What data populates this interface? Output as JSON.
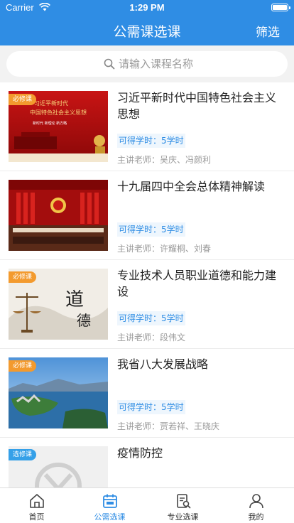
{
  "status": {
    "carrier": "Carrier",
    "time": "1:29 PM"
  },
  "header": {
    "title": "公需课选课",
    "filter_label": "筛选"
  },
  "search": {
    "placeholder": "请输入课程名称"
  },
  "courses": [
    {
      "tag": "必修课",
      "title": "习近平新时代中国特色社会主义思想",
      "hours": "可得学时：5学时",
      "teacher": "主讲老师：吴庆、冯颜利",
      "banner_line1": "习近平新时代",
      "banner_line2": "中国特色社会主义思想",
      "banner_line3": "新时代  新理论  新方略"
    },
    {
      "tag": "",
      "title": "十九届四中全会总体精神解读",
      "hours": "可得学时：5学时",
      "teacher": "主讲老师：许耀桐、刘春"
    },
    {
      "tag": "必修课",
      "title": "专业技术人员职业道德和能力建设",
      "hours": "可得学时：5学时",
      "teacher": "主讲老师：段伟文",
      "calligraphy1": "道",
      "calligraphy2": "德"
    },
    {
      "tag": "必修课",
      "title": "我省八大发展战略",
      "hours": "可得学时：5学时",
      "teacher": "主讲老师：贾若祥、王晓庆"
    },
    {
      "tag": "选修课",
      "title": "疫情防控",
      "hours": "",
      "teacher": ""
    }
  ],
  "tabs": [
    {
      "label": "首页",
      "icon": "home-icon"
    },
    {
      "label": "公需选课",
      "icon": "calendar-icon",
      "active": true
    },
    {
      "label": "专业选课",
      "icon": "doc-search-icon"
    },
    {
      "label": "我的",
      "icon": "user-icon"
    }
  ],
  "colors": {
    "primary": "#2f8de4",
    "required_tag": "#f39a2e",
    "elective_tag": "#35a0e8"
  }
}
